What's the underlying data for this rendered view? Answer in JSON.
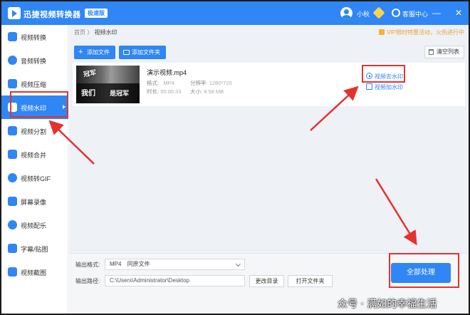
{
  "titlebar": {
    "app_title": "迅捷视频转换器",
    "badge": "极速版",
    "user_name": "小秋",
    "service_label": "客服中心",
    "min_symbol": "—",
    "restore_symbol": "▭",
    "close_symbol": "✕"
  },
  "sidebar": {
    "items": [
      {
        "label": "视频转换",
        "icon": "video-convert-icon"
      },
      {
        "label": "音频转换",
        "icon": "audio-convert-icon"
      },
      {
        "label": "视频压缩",
        "icon": "video-compress-icon"
      },
      {
        "label": "视频水印",
        "icon": "video-watermark-icon",
        "active": true
      },
      {
        "label": "视频分割",
        "icon": "video-split-icon"
      },
      {
        "label": "视频合并",
        "icon": "video-merge-icon"
      },
      {
        "label": "视频转GIF",
        "icon": "video-to-gif-icon"
      },
      {
        "label": "屏幕录像",
        "icon": "screen-record-icon"
      },
      {
        "label": "视频配乐",
        "icon": "video-music-icon"
      },
      {
        "label": "字幕/贴图",
        "icon": "subtitle-sticker-icon"
      },
      {
        "label": "视频截图",
        "icon": "video-screenshot-icon"
      }
    ]
  },
  "breadcrumb": {
    "home": "首页",
    "separator": "〉",
    "current": "视频水印"
  },
  "promo": "VIP限时特惠活动，火热进行中",
  "toolbar": {
    "add_file": "添加文件",
    "add_folder": "添加文件夹",
    "clear_list": "清空列表"
  },
  "file": {
    "name": "演示视频.mp4",
    "format_label": "格式:",
    "format_value": "MP4",
    "resolution_label": "分辨率:",
    "resolution_value": "1280*720",
    "duration_label": "时长:",
    "duration_value": "00:00:33",
    "size_label": "大小:",
    "size_value": "8.58 MB",
    "thumb_cap1": "冠军",
    "thumb_cap2": "我们",
    "thumb_cap3": "是冠军",
    "remove_watermark": "视频去水印",
    "add_watermark": "视频加水印"
  },
  "output": {
    "format_label": "输出格式:",
    "format_value": "MP4",
    "format_option": "同原文件",
    "path_label": "输出路径:",
    "path_value": "C:\\Users\\Administrator\\Desktop",
    "change_dir": "更改目录",
    "open_folder": "打开文件夹",
    "process_all": "全部处理"
  },
  "watermark_text": "众号 · 满如的幸福生活",
  "colors": {
    "accent": "#2f86f4",
    "annotation": "#e5322d"
  }
}
